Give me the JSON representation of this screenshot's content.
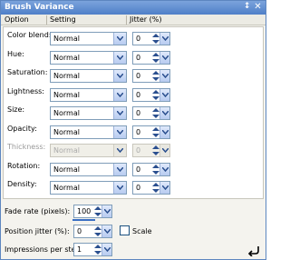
{
  "panel": {
    "title": "Brush Variance",
    "pin_glyph": "↕",
    "close_glyph": "✕"
  },
  "columns": {
    "option": "Option",
    "setting": "Setting",
    "jitter": "Jitter (%)"
  },
  "rows": [
    {
      "label": "Color blend:",
      "setting": "Normal",
      "jitter": "0",
      "enabled": true
    },
    {
      "label": "Hue:",
      "setting": "Normal",
      "jitter": "0",
      "enabled": true
    },
    {
      "label": "Saturation:",
      "setting": "Normal",
      "jitter": "0",
      "enabled": true
    },
    {
      "label": "Lightness:",
      "setting": "Normal",
      "jitter": "0",
      "enabled": true
    },
    {
      "label": "Size:",
      "setting": "Normal",
      "jitter": "0",
      "enabled": true
    },
    {
      "label": "Opacity:",
      "setting": "Normal",
      "jitter": "0",
      "enabled": true
    },
    {
      "label": "Thickness:",
      "setting": "Normal",
      "jitter": "0",
      "enabled": false
    },
    {
      "label": "Rotation:",
      "setting": "Normal",
      "jitter": "0",
      "enabled": true
    },
    {
      "label": "Density:",
      "setting": "Normal",
      "jitter": "0",
      "enabled": true
    }
  ],
  "fade_rate": {
    "label": "Fade rate (pixels):",
    "value": "100"
  },
  "position_jitter": {
    "label": "Position jitter (%):",
    "value": "0",
    "scale_label": "Scale",
    "scale_checked": false
  },
  "impressions": {
    "label": "Impressions per step:",
    "value": "1"
  },
  "colors": {
    "title_bar": "#4f7fc8",
    "border": "#7f9db9",
    "accent": "#3a6fc4"
  },
  "icons": [
    "pin-icon",
    "close-icon",
    "chevron-down-icon",
    "spin-arrows-icon",
    "undo-icon"
  ]
}
